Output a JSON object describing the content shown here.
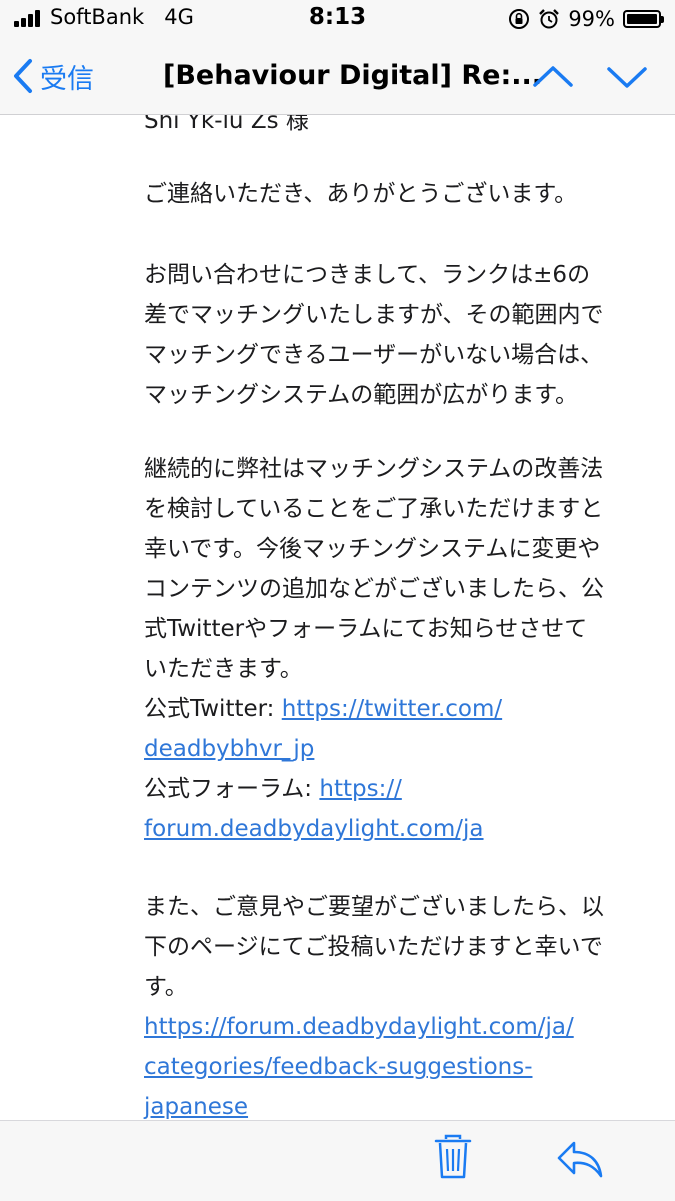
{
  "status_bar": {
    "carrier": "SoftBank",
    "network": "4G",
    "time": "8:13",
    "battery_percent": "99%",
    "icons": [
      "signal-icon",
      "orientation-lock-icon",
      "alarm-icon",
      "battery-icon"
    ]
  },
  "nav": {
    "back_label": "受信",
    "title": "[Behaviour Digital] Re:...",
    "accent_color": "#1a7bf2"
  },
  "email": {
    "cutoff_line": "Shi Yk-lu Zs 様",
    "greeting": "ご連絡いただき、ありがとうございます。",
    "para1": [
      "お問い合わせにつきまして、ランクは±6の",
      "差でマッチングいたしますが、その範囲内で",
      "マッチングできるユーザーがいない場合は、",
      "マッチングシステムの範囲が広がります。"
    ],
    "para2": [
      "継続的に弊社はマッチングシステムの改善法",
      "を検討していることをご了承いただけますと",
      "幸いです。今後マッチングシステムに変更や",
      "コンテンツの追加などがございましたら、公",
      "式Twitterやフォーラムにてお知らせさせて",
      "いただきます。"
    ],
    "twitter_label": "公式Twitter: ",
    "twitter_link_1": "https://twitter.com/",
    "twitter_link_2": "deadbybhvr_jp",
    "forum_label": "公式フォーラム: ",
    "forum_link_1": "https://",
    "forum_link_2": "forum.deadbydaylight.com/ja",
    "para3": [
      "また、ご意見やご要望がございましたら、以",
      "下のページにてご投稿いただけますと幸いで",
      "す。"
    ],
    "feedback_link": [
      "https://forum.deadbydaylight.com/ja/",
      "categories/feedback-suggestions-",
      "japanese"
    ],
    "link_color": "#2f77d8"
  },
  "toolbar": {
    "icons": [
      "trash-icon",
      "reply-icon"
    ]
  }
}
